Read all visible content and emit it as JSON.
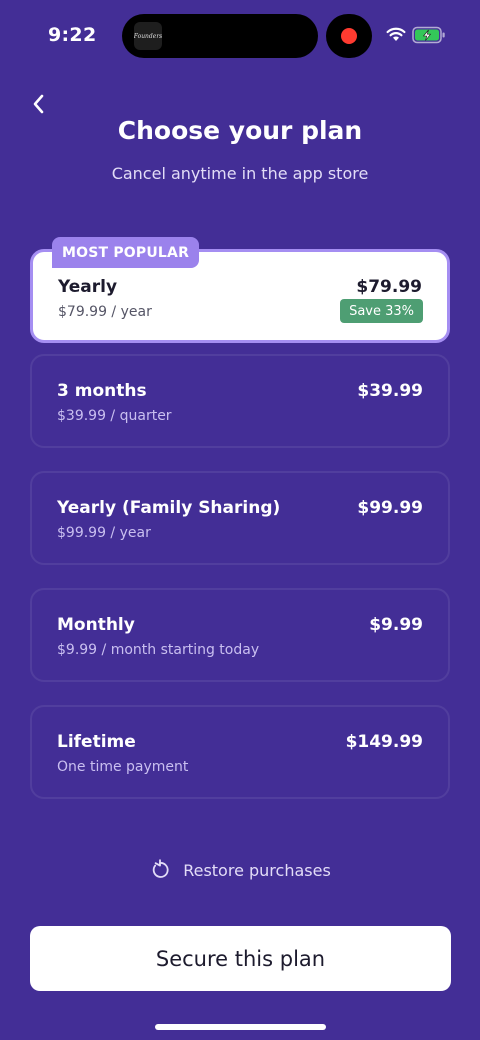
{
  "status_bar": {
    "time": "9:22",
    "island_thumb_label": "Founders",
    "wifi_icon": "wifi-icon",
    "battery_icon": "battery-charging-icon",
    "record_indicator_color": "#ff3b30"
  },
  "header": {
    "back_icon": "chevron-left-icon",
    "title": "Choose your plan",
    "subtitle": "Cancel anytime in the app store"
  },
  "plans": [
    {
      "name": "Yearly",
      "detail": "$79.99 / year",
      "price": "$79.99",
      "badge": "MOST POPULAR",
      "savings": "Save 33%",
      "selected": true
    },
    {
      "name": "3 months",
      "detail": "$39.99 / quarter",
      "price": "$39.99",
      "selected": false
    },
    {
      "name": "Yearly (Family Sharing)",
      "detail": "$99.99 / year",
      "price": "$99.99",
      "selected": false
    },
    {
      "name": "Monthly",
      "detail": "$9.99 / month starting today",
      "price": "$9.99",
      "selected": false
    },
    {
      "name": "Lifetime",
      "detail": "One time payment",
      "price": "$149.99",
      "selected": false
    }
  ],
  "restore": {
    "icon": "restore-icon",
    "label": "Restore purchases"
  },
  "cta": {
    "label": "Secure this plan"
  },
  "colors": {
    "background": "#432e96",
    "selected_border": "#a58ef2",
    "popular_badge": "#9b82ec",
    "save_badge": "#4e9e73",
    "cta_background": "#ffffff"
  }
}
